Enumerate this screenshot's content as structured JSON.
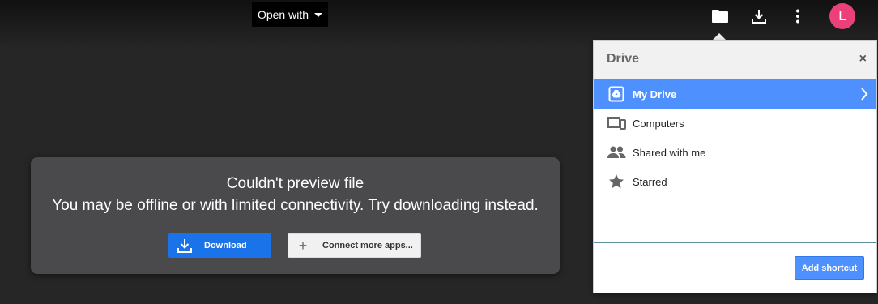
{
  "toolbar": {
    "open_with_label": "Open with",
    "avatar_initial": "L",
    "avatar_color": "#ec407a"
  },
  "error": {
    "title": "Couldn't preview file",
    "message": "You may be offline or with limited connectivity. Try downloading instead.",
    "download_label": "Download",
    "connect_label": "Connect more apps..."
  },
  "drive_panel": {
    "title": "Drive",
    "close_glyph": "×",
    "items": [
      {
        "label": "My Drive",
        "icon": "my-drive-icon",
        "selected": true
      },
      {
        "label": "Computers",
        "icon": "computers-icon",
        "selected": false
      },
      {
        "label": "Shared with me",
        "icon": "shared-icon",
        "selected": false
      },
      {
        "label": "Starred",
        "icon": "star-icon",
        "selected": false
      }
    ],
    "add_shortcut_label": "Add shortcut"
  },
  "colors": {
    "accent_blue": "#4d90fe",
    "download_blue": "#1a73e8",
    "card_bg": "#4a494b"
  }
}
